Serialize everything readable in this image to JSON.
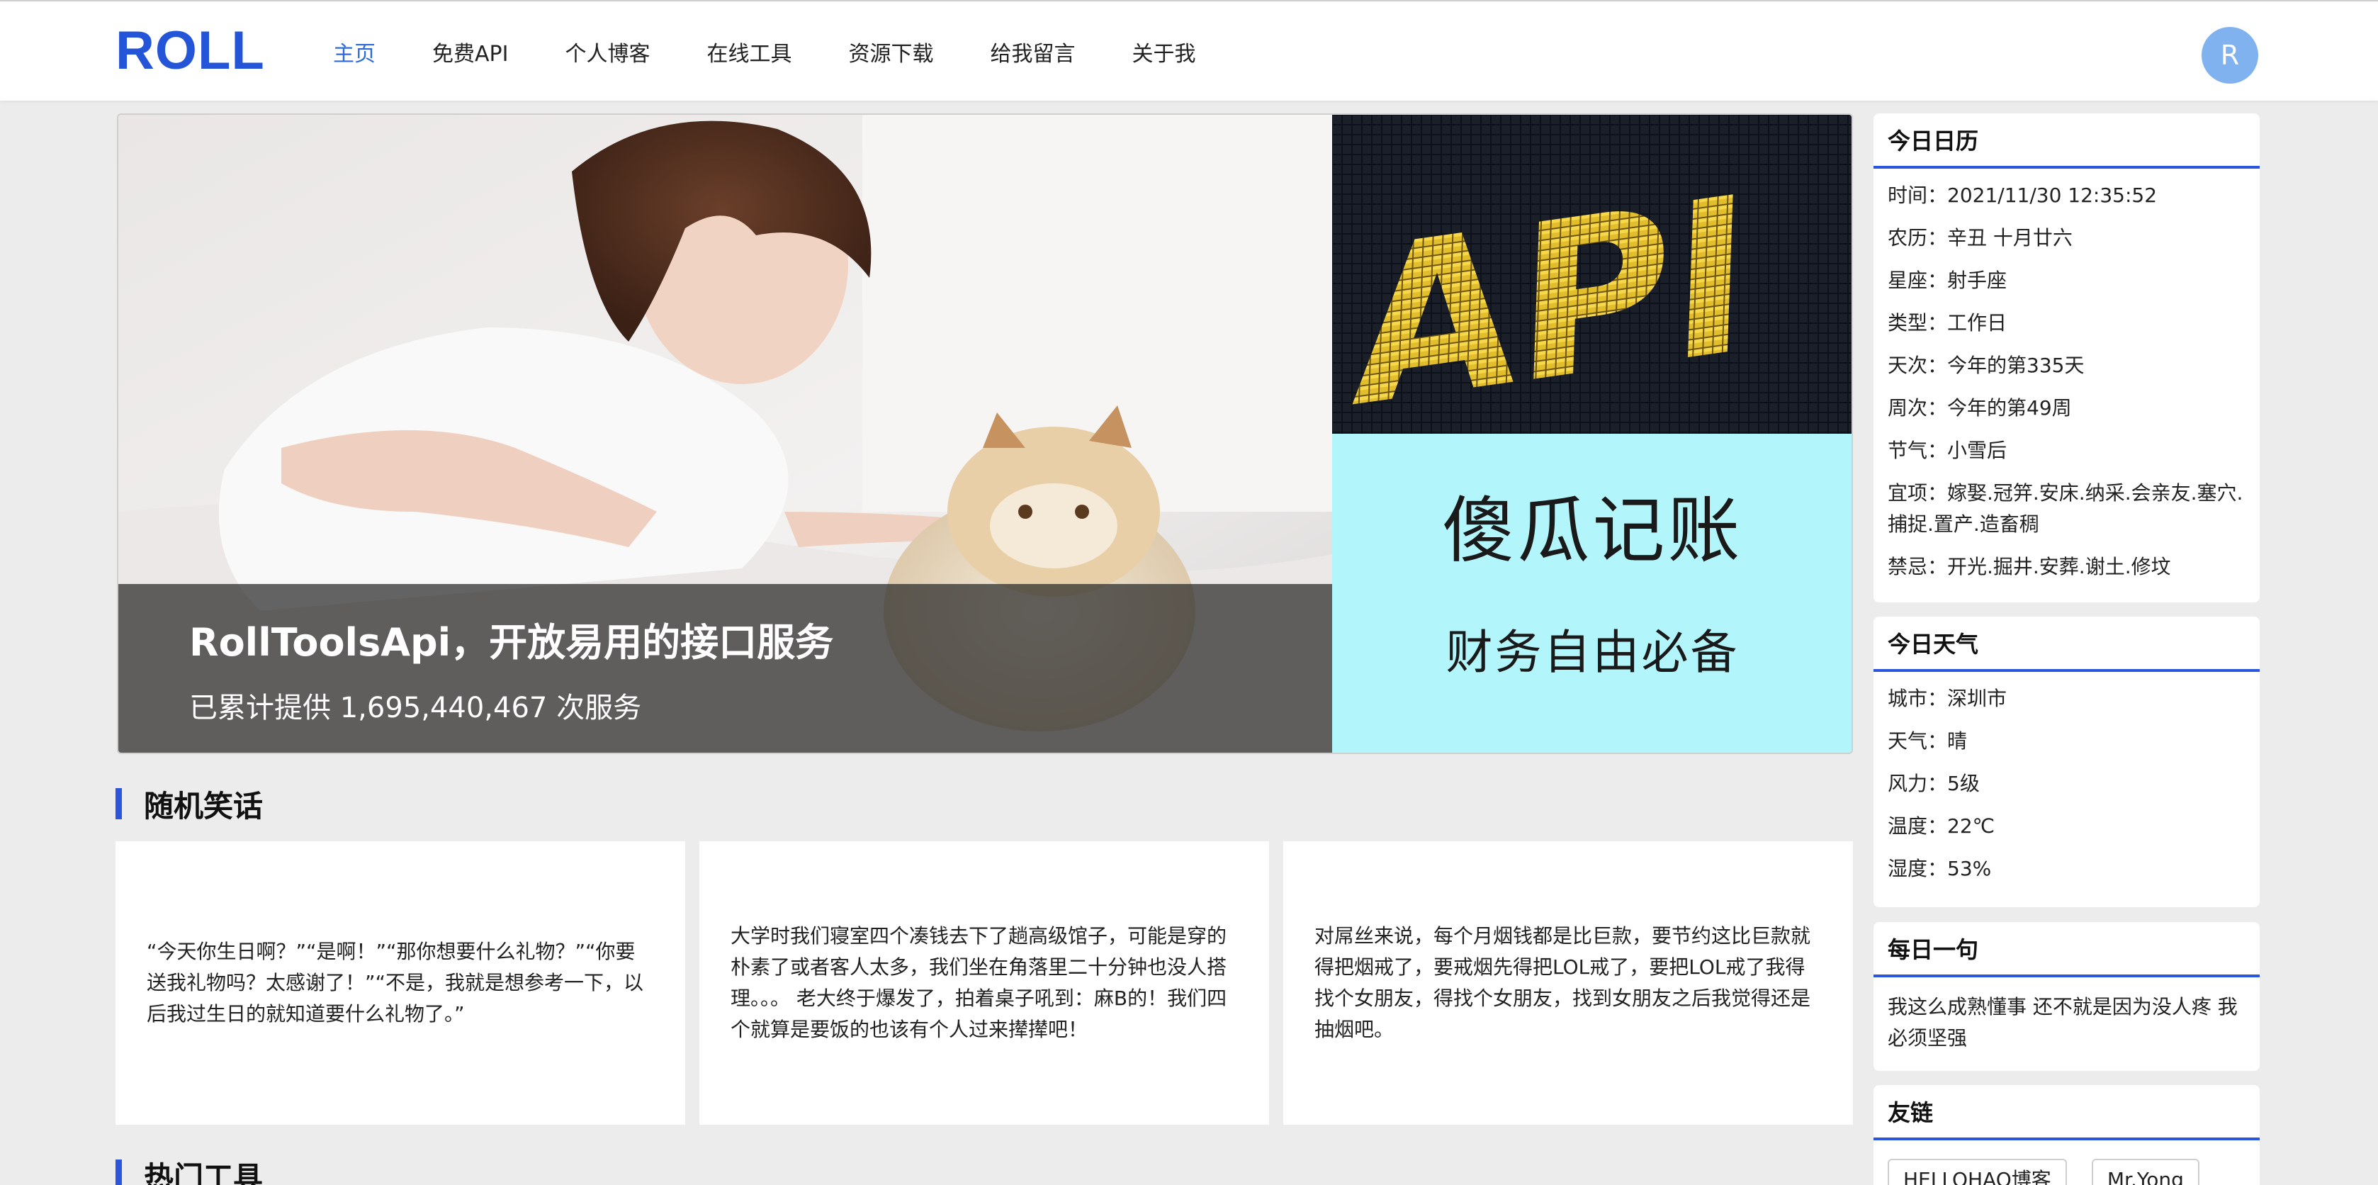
{
  "header": {
    "logo": "ROLL",
    "nav": [
      "主页",
      "免费API",
      "个人博客",
      "在线工具",
      "资源下载",
      "给我留言",
      "关于我"
    ],
    "avatar_letter": "R"
  },
  "banner": {
    "title": "RollToolsApi，开放易用的接口服务",
    "subtitle": "已累计提供 1,695,440,467 次服务",
    "api_text": "API",
    "ad_title": "傻瓜记账",
    "ad_subtitle": "财务自由必备"
  },
  "jokes": {
    "section_title": "随机笑话",
    "items": [
      "“今天你生日啊？”“是啊！”“那你想要什么礼物？”“你要送我礼物吗？太感谢了！”“不是，我就是想参考一下，以后我过生日的就知道要什么礼物了。”",
      "大学时我们寝室四个凑钱去下了趟高级馆子，可能是穿的朴素了或者客人太多，我们坐在角落里二十分钟也没人搭理。。。 老大终于爆发了，拍着桌子吼到：麻B的！我们四个就算是要饭的也该有个人过来撵撵吧！",
      "对屌丝来说，每个月烟钱都是比巨款，要节约这比巨款就得把烟戒了，要戒烟先得把LOL戒了，要把LOL戒了我得找个女朋友，得找个女朋友，找到女朋友之后我觉得还是抽烟吧。"
    ]
  },
  "tools": {
    "section_title": "热门工具"
  },
  "calendar": {
    "title": "今日日历",
    "rows": [
      "时间：2021/11/30 12:35:52",
      "农历：辛丑 十月廿六",
      "星座：射手座",
      "类型：工作日",
      "天次：今年的第335天",
      "周次：今年的第49周",
      "节气：小雪后",
      "宜项：嫁娶.冠笄.安床.纳采.会亲友.塞穴.捕捉.置产.造畜稠",
      "禁忌：开光.掘井.安葬.谢土.修坟"
    ]
  },
  "weather": {
    "title": "今日天气",
    "rows": [
      "城市：深圳市",
      "天气：晴",
      "风力：5级",
      "温度：22℃",
      "湿度：53%"
    ]
  },
  "quote": {
    "title": "每日一句",
    "text": "我这么成熟懂事 还不就是因为没人疼 我必须坚强"
  },
  "links": {
    "title": "友链",
    "items": [
      "HELLOHAO博客",
      "Mr.Yong"
    ]
  },
  "colors": {
    "accent": "#2455d9",
    "nav_active": "#2f6bd8",
    "ad_background": "#b2f5fb",
    "avatar": "#7fb2ef"
  }
}
